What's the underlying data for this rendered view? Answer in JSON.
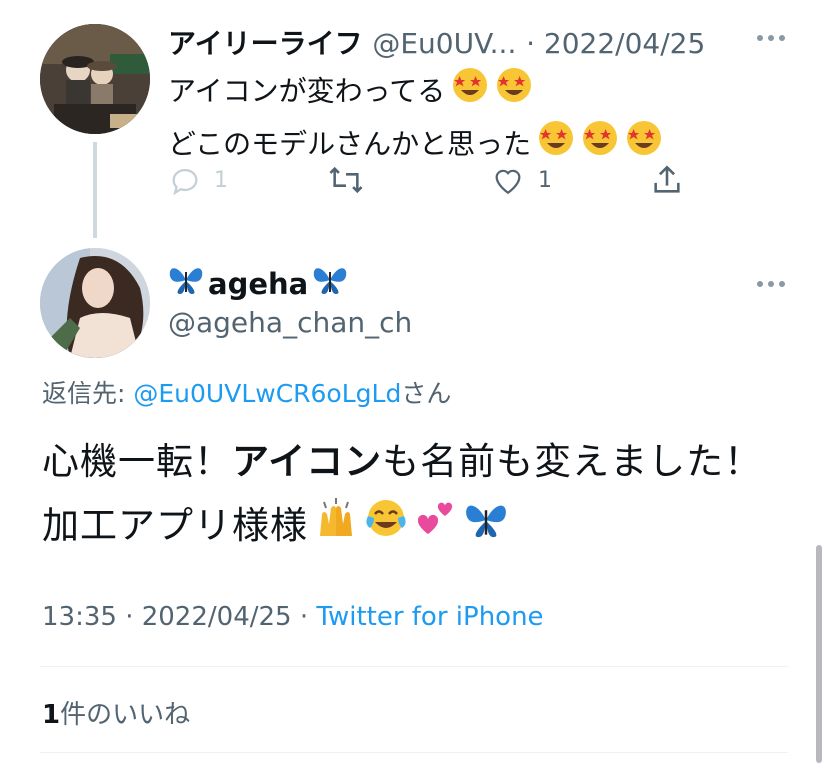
{
  "reply_tweet": {
    "display_name": "アイリーライフ",
    "handle": "@Eu0UV...",
    "date": "· 2022/04/25",
    "more_icon": "more-horizontal-icon",
    "line1": "アイコンが変わってる",
    "line2": "どこのモデルさんかと思った",
    "line1_emoji": [
      "star-struck-emoji",
      "star-struck-emoji"
    ],
    "line2_emoji": [
      "star-struck-emoji",
      "star-struck-emoji",
      "star-struck-emoji"
    ],
    "actions": {
      "reply_count": "1",
      "like_count": "1",
      "icons": [
        "reply-icon",
        "retweet-icon",
        "like-icon",
        "share-icon"
      ]
    }
  },
  "main_tweet": {
    "display_name": "ageha",
    "name_emoji": [
      "butterfly-emoji",
      "butterfly-emoji"
    ],
    "handle": "@ageha_chan_ch",
    "reply_to_prefix": "返信先: ",
    "reply_to_handle": "@Eu0UVLwCR6oLgLd",
    "reply_to_suffix": "さん",
    "text_part1": "心機一転！",
    "text_bold": "アイコン",
    "text_part2": "も名前も変えました！加工アプリ様様",
    "text_emoji": [
      "raising-hands-emoji",
      "joy-emoji",
      "two-hearts-emoji",
      "butterfly-emoji"
    ],
    "time": "13:35 · 2022/04/25 · ",
    "source": "Twitter for iPhone",
    "likes_count": "1",
    "likes_label": "件のいいね"
  },
  "colors": {
    "accent": "#1d9bf0",
    "secondary_text": "#536471",
    "icon_gray": "#8b98a5",
    "divider": "#eff3f4"
  }
}
